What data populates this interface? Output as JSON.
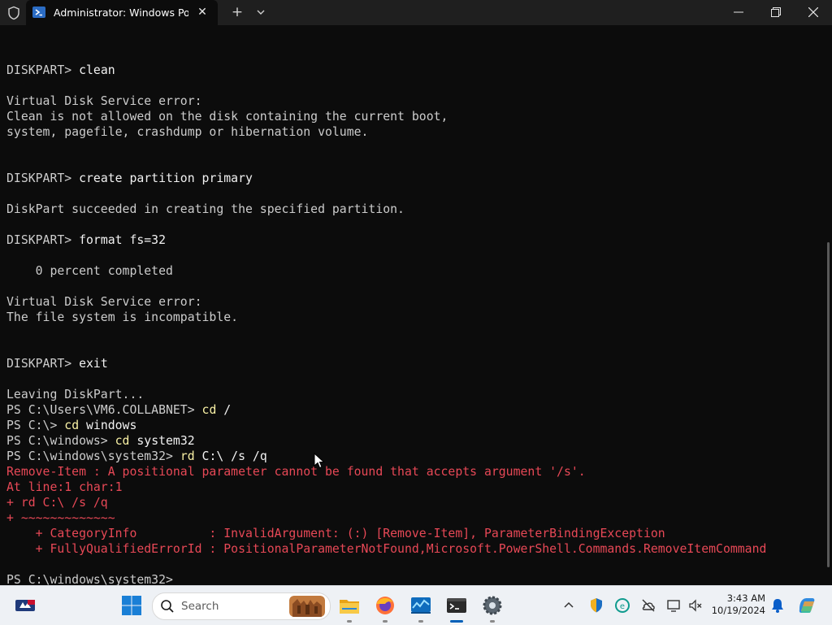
{
  "window": {
    "tab_title": "Administrator: Windows PowerShell",
    "colors": {
      "titlebar": "#1f1f1f",
      "terminal_bg": "#0c0c0c",
      "text": "#cccccc",
      "error": "#e74856",
      "command": "#f9f1a5"
    }
  },
  "terminal": {
    "lines": [
      {
        "prompt": "",
        "text": ""
      },
      {
        "prompt": "DISKPART> ",
        "text": "clean"
      },
      {
        "prompt": "",
        "text": ""
      },
      {
        "prompt": "",
        "text": "Virtual Disk Service error:"
      },
      {
        "prompt": "",
        "text": "Clean is not allowed on the disk containing the current boot,"
      },
      {
        "prompt": "",
        "text": "system, pagefile, crashdump or hibernation volume."
      },
      {
        "prompt": "",
        "text": ""
      },
      {
        "prompt": "",
        "text": ""
      },
      {
        "prompt": "DISKPART> ",
        "text": "create partition primary"
      },
      {
        "prompt": "",
        "text": ""
      },
      {
        "prompt": "",
        "text": "DiskPart succeeded in creating the specified partition."
      },
      {
        "prompt": "",
        "text": ""
      },
      {
        "prompt": "DISKPART> ",
        "text": "format fs=32"
      },
      {
        "prompt": "",
        "text": ""
      },
      {
        "prompt": "",
        "text": "    0 percent completed"
      },
      {
        "prompt": "",
        "text": ""
      },
      {
        "prompt": "",
        "text": "Virtual Disk Service error:"
      },
      {
        "prompt": "",
        "text": "The file system is incompatible."
      },
      {
        "prompt": "",
        "text": ""
      },
      {
        "prompt": "",
        "text": ""
      },
      {
        "prompt": "DISKPART> ",
        "text": "exit"
      },
      {
        "prompt": "",
        "text": ""
      },
      {
        "prompt": "",
        "text": "Leaving DiskPart..."
      },
      {
        "prompt": "PS C:\\Users\\VM6.COLLABNET> ",
        "cmd": "cd",
        "text": " /"
      },
      {
        "prompt": "PS C:\\> ",
        "cmd": "cd",
        "text": " windows"
      },
      {
        "prompt": "PS C:\\windows> ",
        "cmd": "cd",
        "text": " system32"
      },
      {
        "prompt": "PS C:\\windows\\system32> ",
        "cmd": "rd",
        "text": " C:\\ /s /q"
      },
      {
        "prompt": "",
        "text": "Remove-Item : A positional parameter cannot be found that accepts argument '/s'.",
        "error": true
      },
      {
        "prompt": "",
        "text": "At line:1 char:1",
        "error": true
      },
      {
        "prompt": "",
        "text": "+ rd C:\\ /s /q",
        "error": true
      },
      {
        "prompt": "",
        "text": "+ ~~~~~~~~~~~~~",
        "error": true
      },
      {
        "prompt": "",
        "text": "    + CategoryInfo          : InvalidArgument: (:) [Remove-Item], ParameterBindingException",
        "error": true
      },
      {
        "prompt": "",
        "text": "    + FullyQualifiedErrorId : PositionalParameterNotFound,Microsoft.PowerShell.Commands.RemoveItemCommand",
        "error": true
      },
      {
        "prompt": "",
        "text": ""
      },
      {
        "prompt": "PS C:\\windows\\system32> ",
        "text": ""
      }
    ]
  },
  "taskbar": {
    "search_label": "Search",
    "time": "3:43 AM",
    "date": "10/19/2024",
    "apps": [
      "windows-start",
      "file-explorer",
      "firefox",
      "resource-monitor",
      "terminal",
      "settings"
    ]
  }
}
